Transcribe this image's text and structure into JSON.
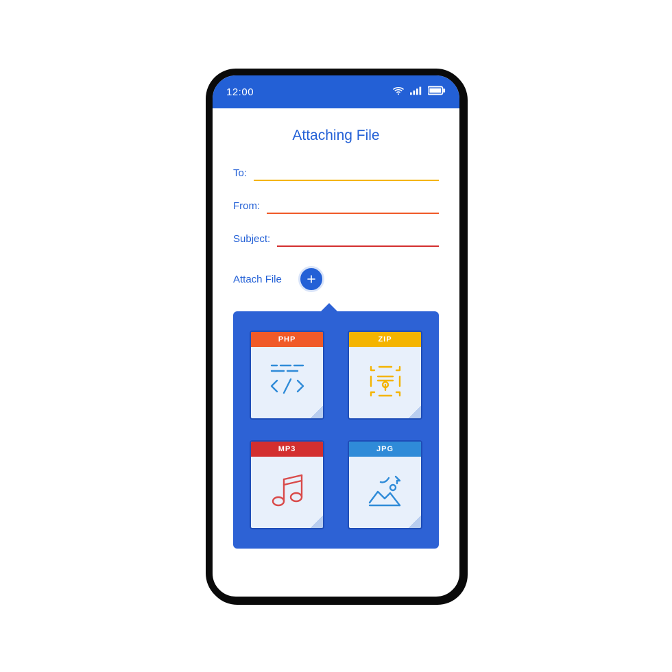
{
  "status": {
    "time": "12:00"
  },
  "page": {
    "title": "Attaching File",
    "fields": {
      "to_label": "To:",
      "from_label": "From:",
      "subject_label": "Subject:"
    },
    "attach_label": "Attach File"
  },
  "popover": {
    "files": [
      {
        "type": "PHP",
        "accent": "orange",
        "icon": "code"
      },
      {
        "type": "ZIP",
        "accent": "yellow",
        "icon": "archive"
      },
      {
        "type": "MP3",
        "accent": "red",
        "icon": "music"
      },
      {
        "type": "JPG",
        "accent": "blue",
        "icon": "image"
      }
    ]
  },
  "colors": {
    "primary": "#2360d6",
    "popover": "#2d62d5",
    "card_bg": "#e8f0fb"
  }
}
